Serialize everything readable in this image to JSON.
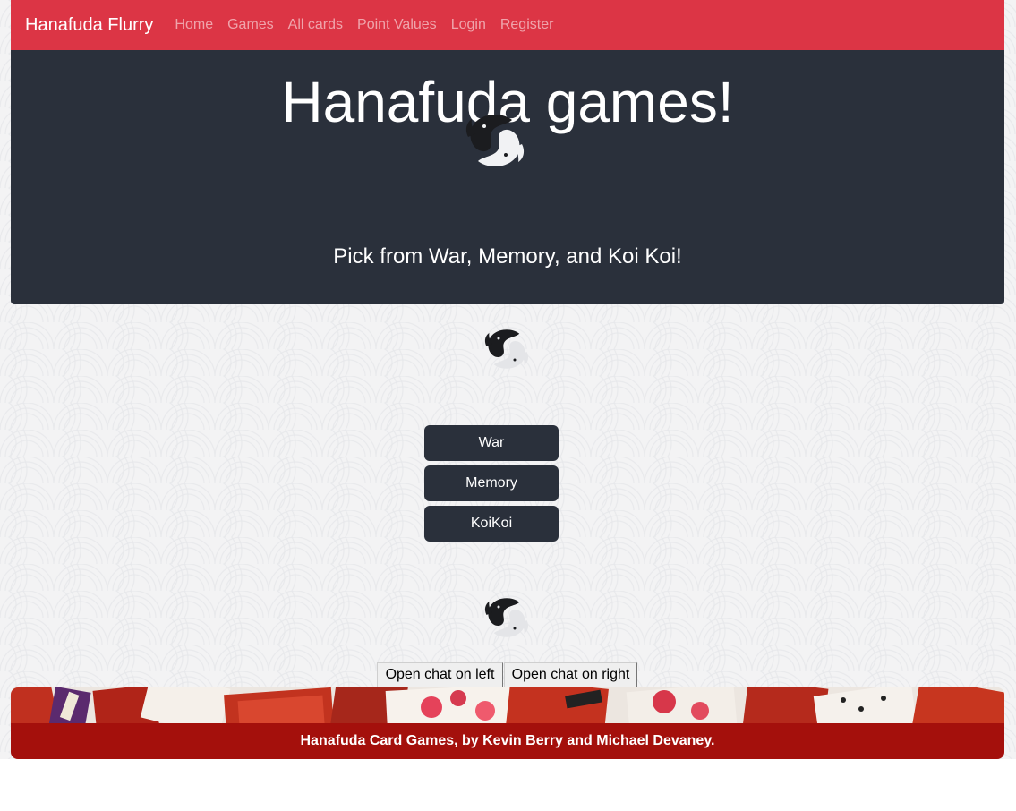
{
  "navbar": {
    "brand": "Hanafuda Flurry",
    "links": [
      "Home",
      "Games",
      "All cards",
      "Point Values",
      "Login",
      "Register"
    ]
  },
  "hero": {
    "title": "Hanafuda games!",
    "subtitle": "Pick from War, Memory, and Koi Koi!"
  },
  "games": {
    "buttons": [
      "War",
      "Memory",
      "KoiKoi"
    ]
  },
  "chat": {
    "left_label": "Open chat on left",
    "right_label": "Open chat on right"
  },
  "footer": {
    "text": "Hanafuda Card Games, by Kevin Berry and Michael Devaney."
  },
  "colors": {
    "navbar": "#dc3545",
    "hero": "#2a303b",
    "game_button": "#2a303b",
    "footer_bar": "#a4100c"
  },
  "icons": {
    "logo": "koi-yin-yang-icon"
  }
}
